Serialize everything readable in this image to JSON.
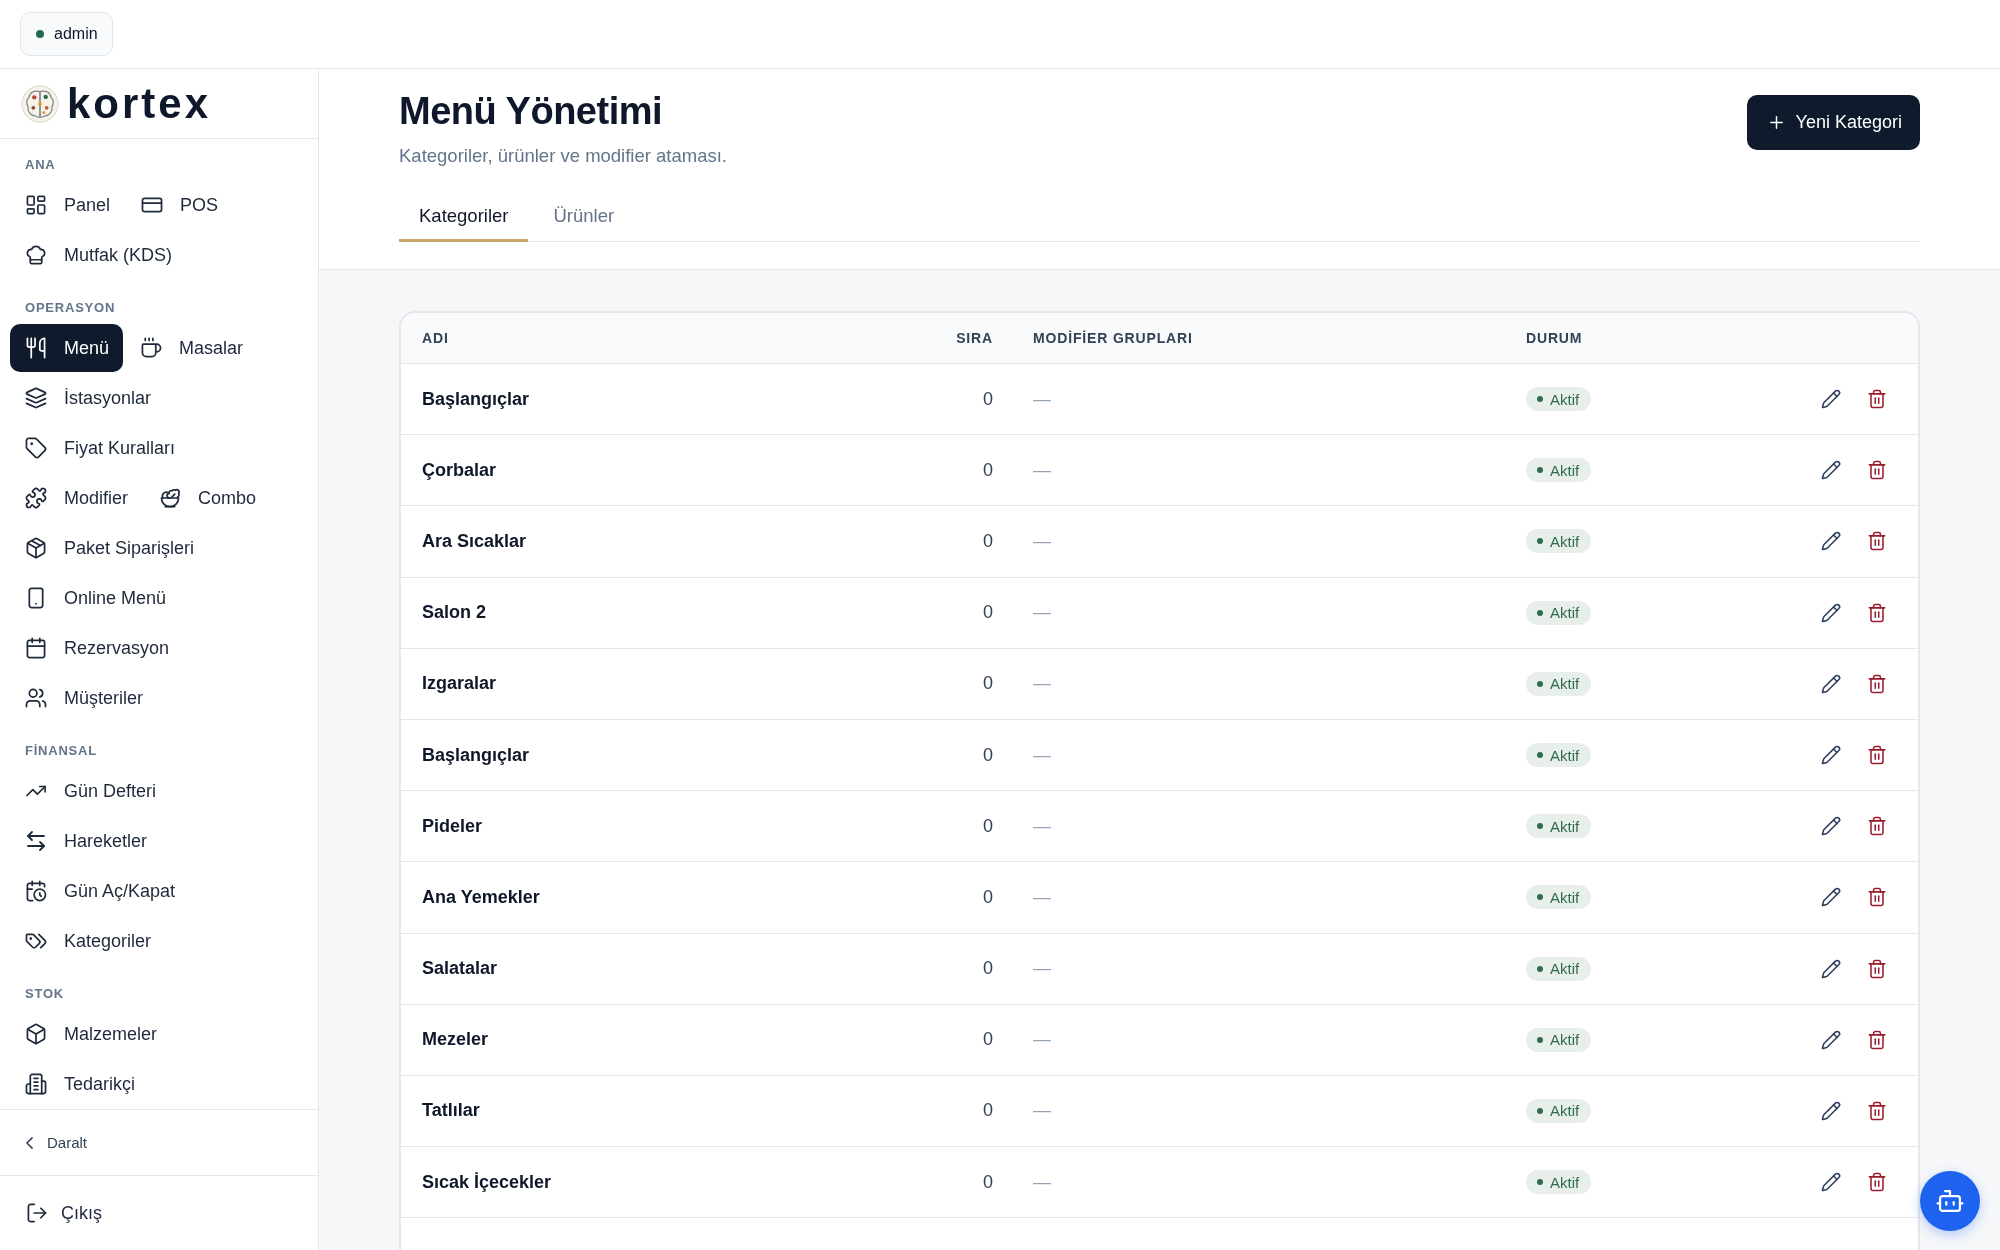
{
  "top_bar": {
    "user": {
      "name": "admin",
      "online": true
    }
  },
  "sidebar": {
    "logo": "kortex",
    "sections": [
      {
        "label": "ANA",
        "items": [
          {
            "label": "Panel",
            "selected": false
          },
          {
            "label": "POS",
            "selected": false
          },
          {
            "label": "Mutfak (KDS)",
            "selected": false
          }
        ]
      },
      {
        "label": "OPERASYON",
        "items": [
          {
            "label": "Menü",
            "selected": true
          },
          {
            "label": "Masalar",
            "selected": false
          },
          {
            "label": "İstasyonlar",
            "selected": false
          },
          {
            "label": "Fiyat Kuralları",
            "selected": false
          },
          {
            "label": "Modifier",
            "selected": false
          },
          {
            "label": "Combo",
            "selected": false
          },
          {
            "label": "Paket Siparişleri",
            "selected": false
          },
          {
            "label": "Online Menü",
            "selected": false
          },
          {
            "label": "Rezervasyon",
            "selected": false
          },
          {
            "label": "Müşteriler",
            "selected": false
          }
        ]
      },
      {
        "label": "FİNANSAL",
        "items": [
          {
            "label": "Gün Defteri",
            "selected": false
          },
          {
            "label": "Hareketler",
            "selected": false
          },
          {
            "label": "Gün Aç/Kapat",
            "selected": false
          },
          {
            "label": "Kategoriler",
            "selected": false
          }
        ]
      },
      {
        "label": "STOK",
        "items": [
          {
            "label": "Malzemeler",
            "selected": false
          },
          {
            "label": "Tedarikçi",
            "selected": false
          }
        ]
      }
    ],
    "collapse_button": "Daralt",
    "logout_button": "Çıkış"
  },
  "page": {
    "title": "Menü Yönetimi",
    "subtitle": "Kategoriler, ürünler ve modifier ataması.",
    "new_button": "Yeni Kategori",
    "tabs": [
      {
        "label": "Kategoriler",
        "selected": true
      },
      {
        "label": "Ürünler",
        "selected": false
      }
    ]
  },
  "table": {
    "columns": [
      "ADI",
      "SIRA",
      "MODİFİER GRUPLARI",
      "DURUM"
    ],
    "rows": [
      {
        "name": "Başlangıçlar",
        "order": "0",
        "modifier_groups": "—",
        "status": "Aktif",
        "active": true
      },
      {
        "name": "Çorbalar",
        "order": "0",
        "modifier_groups": "—",
        "status": "Aktif",
        "active": true
      },
      {
        "name": "Ara Sıcaklar",
        "order": "0",
        "modifier_groups": "—",
        "status": "Aktif",
        "active": true
      },
      {
        "name": "Salon 2",
        "order": "0",
        "modifier_groups": "—",
        "status": "Aktif",
        "active": true
      },
      {
        "name": "Izgaralar",
        "order": "0",
        "modifier_groups": "—",
        "status": "Aktif",
        "active": true
      },
      {
        "name": "Başlangıçlar",
        "order": "0",
        "modifier_groups": "—",
        "status": "Aktif",
        "active": true
      },
      {
        "name": "Pideler",
        "order": "0",
        "modifier_groups": "—",
        "status": "Aktif",
        "active": true
      },
      {
        "name": "Ana Yemekler",
        "order": "0",
        "modifier_groups": "—",
        "status": "Aktif",
        "active": true
      },
      {
        "name": "Salatalar",
        "order": "0",
        "modifier_groups": "—",
        "status": "Aktif",
        "active": true
      },
      {
        "name": "Mezeler",
        "order": "0",
        "modifier_groups": "—",
        "status": "Aktif",
        "active": true
      },
      {
        "name": "Tatlılar",
        "order": "0",
        "modifier_groups": "—",
        "status": "Aktif",
        "active": true
      },
      {
        "name": "Sıcak İçecekler",
        "order": "0",
        "modifier_groups": "—",
        "status": "Aktif",
        "active": true
      }
    ]
  }
}
